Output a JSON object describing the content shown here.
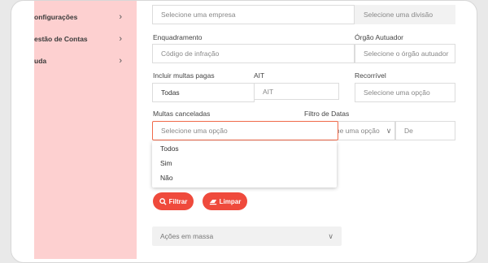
{
  "sidebar": {
    "items": [
      {
        "label": "onfigurações"
      },
      {
        "label": "estão de Contas"
      },
      {
        "label": "uda"
      }
    ]
  },
  "filters": {
    "empresa_placeholder": "Selecione uma empresa",
    "divisao_placeholder": "Selecione uma divisão",
    "enquadramento_label": "Enquadramento",
    "enquadramento_placeholder": "Código de infração",
    "orgao_label": "Órgão Autuador",
    "orgao_placeholder": "Selecione o órgão autuador",
    "incluir_label": "Incluir multas pagas",
    "incluir_value": "Todas",
    "ait_label": "AIT",
    "ait_placeholder": "AIT",
    "recorrivel_label": "Recorrível",
    "recorrivel_placeholder": "Selecione uma opção",
    "canceladas_label": "Multas canceladas",
    "canceladas_placeholder": "Selecione uma opção",
    "filtro_datas_label": "Filtro de Datas",
    "filtro_datas_placeholder": "Selecione uma opção",
    "de_placeholder": "De"
  },
  "dropdown": {
    "options": [
      "Todos",
      "Sim",
      "Não"
    ]
  },
  "actions": {
    "filtrar": "Filtrar",
    "limpar": "Limpar",
    "mass_actions": "Ações em massa"
  },
  "colors": {
    "accent": "#ef4a3c",
    "sidebar": "#fdd0d0"
  }
}
